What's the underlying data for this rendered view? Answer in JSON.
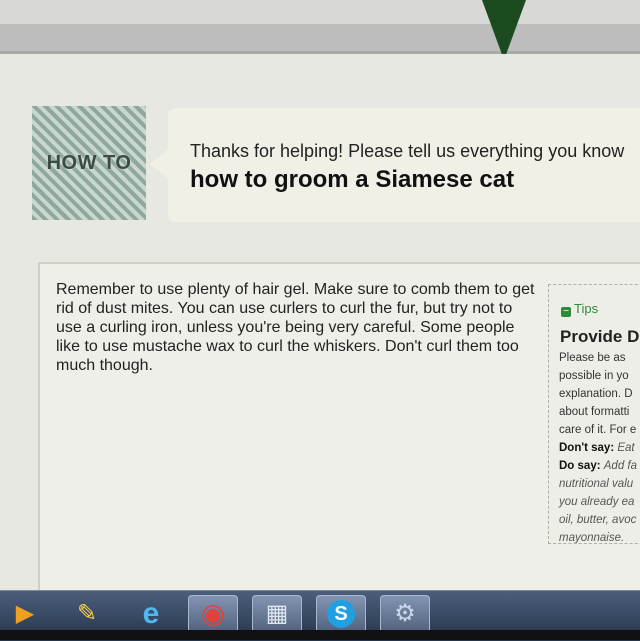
{
  "howto": {
    "badge_text": "HOW TO"
  },
  "prompt": {
    "intro": "Thanks for helping! Please tell us everything you know",
    "title": "how to groom a Siamese cat"
  },
  "answer": {
    "text": "Remember to use plenty of hair gel.  Make sure to comb them to get rid of dust mites.  You can use curlers to curl the fur, but try not to use a curling iron, unless you're being very careful.  Some people like to use mustache wax to curl the whiskers.  Don't curl them too much though."
  },
  "tips": {
    "label": "Tips",
    "title": "Provide D",
    "lines": [
      "Please be as",
      "possible in yo",
      "explanation. D",
      "about formatti",
      "care of it. For e"
    ],
    "dont_say_label": "Don't say",
    "dont_say_value": "Eat",
    "do_say_label": "Do say",
    "do_say_value": "Add fa",
    "more_lines": [
      "nutritional valu",
      "you already ea",
      "oil, butter, avoc",
      "mayonnaise."
    ]
  },
  "taskbar": {
    "items": [
      {
        "name": "media-player-icon",
        "glyph": "▶"
      },
      {
        "name": "paint-icon",
        "glyph": "✎"
      },
      {
        "name": "internet-explorer-icon",
        "glyph": "e"
      },
      {
        "name": "chrome-icon",
        "glyph": "◉"
      },
      {
        "name": "calculator-icon",
        "glyph": "▦"
      },
      {
        "name": "skype-icon",
        "glyph": "S"
      },
      {
        "name": "control-panel-icon",
        "glyph": "⚙"
      }
    ]
  }
}
